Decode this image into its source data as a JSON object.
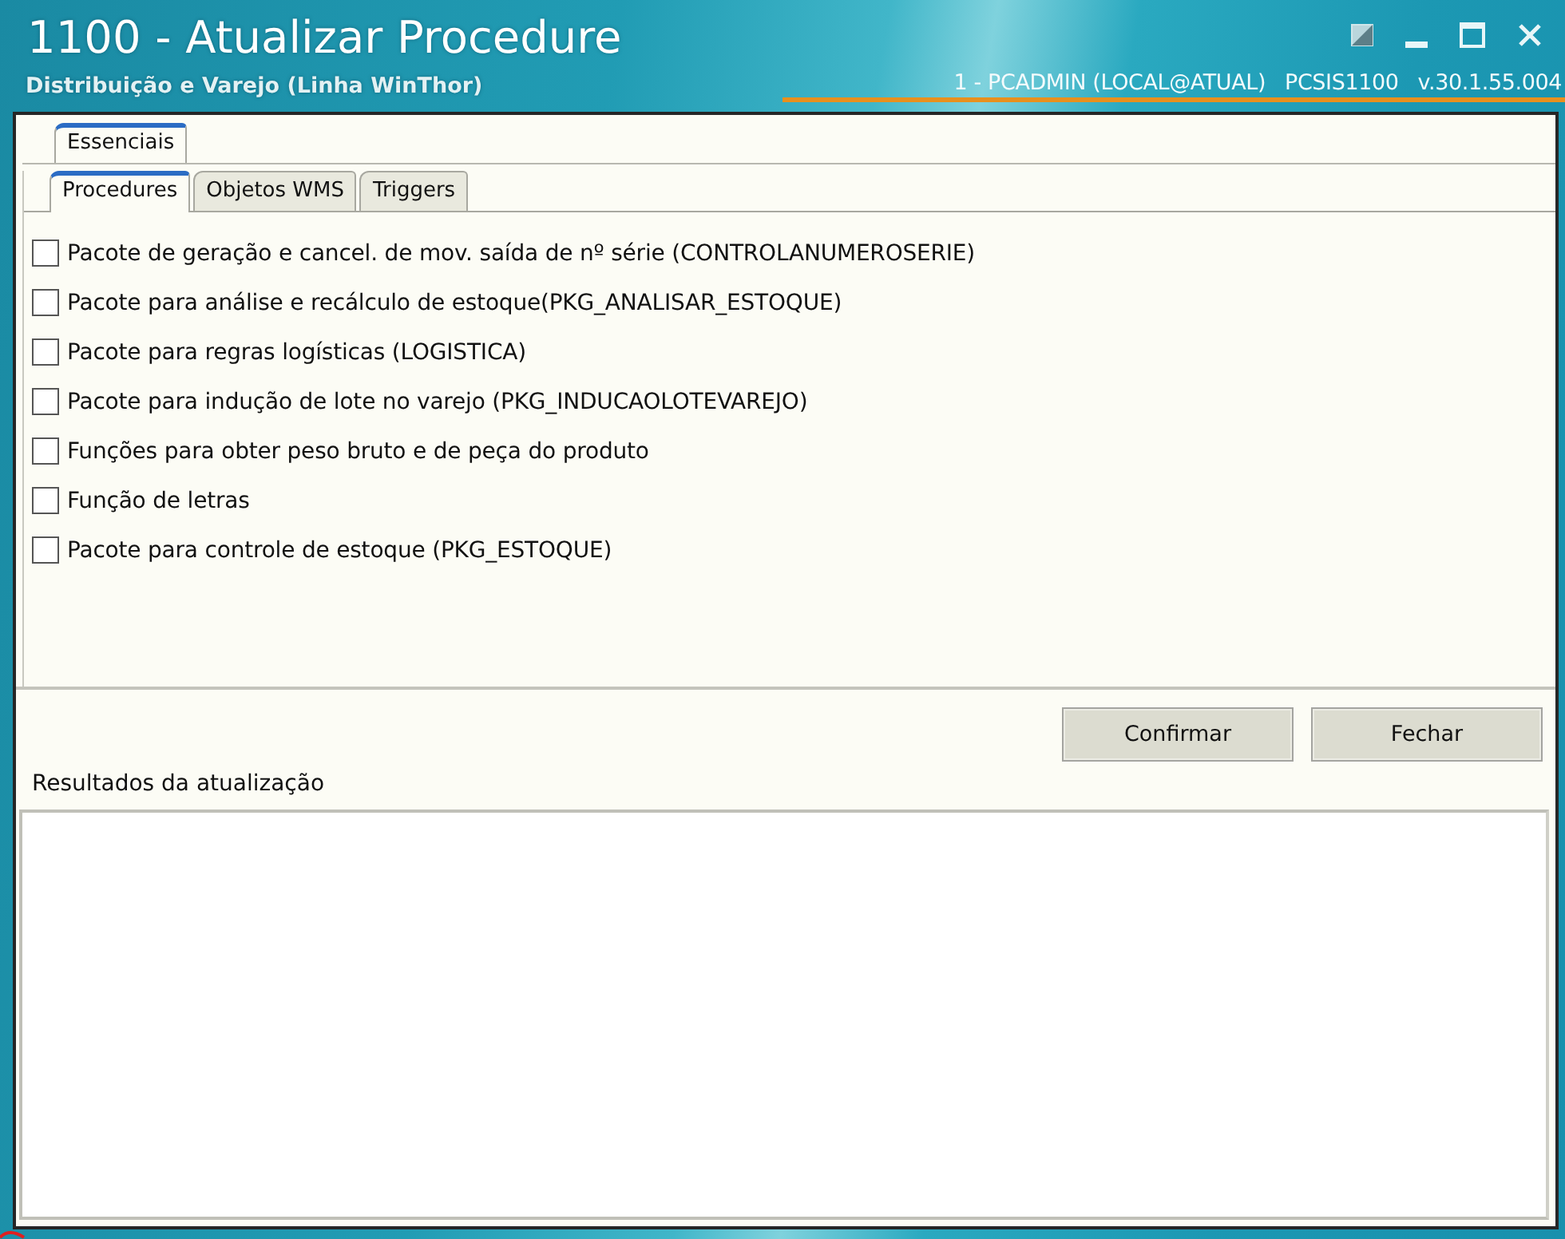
{
  "window": {
    "title": "1100 - Atualizar Procedure",
    "subtitle": "Distribuição e Varejo (Linha WinThor)",
    "user": "1 - PCADMIN (LOCAL@ATUAL)",
    "program": "PCSIS1100",
    "version": "v.30.1.55.004"
  },
  "outer_tabs": [
    {
      "label": "Essenciais",
      "selected": true
    }
  ],
  "tabs": [
    {
      "label": "Procedures",
      "selected": true
    },
    {
      "label": "Objetos WMS",
      "selected": false
    },
    {
      "label": "Triggers",
      "selected": false
    }
  ],
  "options": [
    {
      "label": "Pacote de geração e cancel. de mov. saída de nº série (CONTROLANUMEROSERIE)",
      "checked": false
    },
    {
      "label": "Pacote para análise e recálculo de estoque(PKG_ANALISAR_ESTOQUE)",
      "checked": false
    },
    {
      "label": "Pacote para regras logísticas (LOGISTICA)",
      "checked": false
    },
    {
      "label": "Pacote para indução de lote no varejo (PKG_INDUCAOLOTEVAREJO)",
      "checked": false
    },
    {
      "label": "Funções para obter peso bruto e de peça do produto",
      "checked": false
    },
    {
      "label": "Função de letras",
      "checked": false
    },
    {
      "label": "Pacote para controle de estoque (PKG_ESTOQUE)",
      "checked": false
    }
  ],
  "buttons": [
    "Confirmar",
    "Fechar"
  ],
  "results": {
    "title": "Resultados da atualização"
  }
}
